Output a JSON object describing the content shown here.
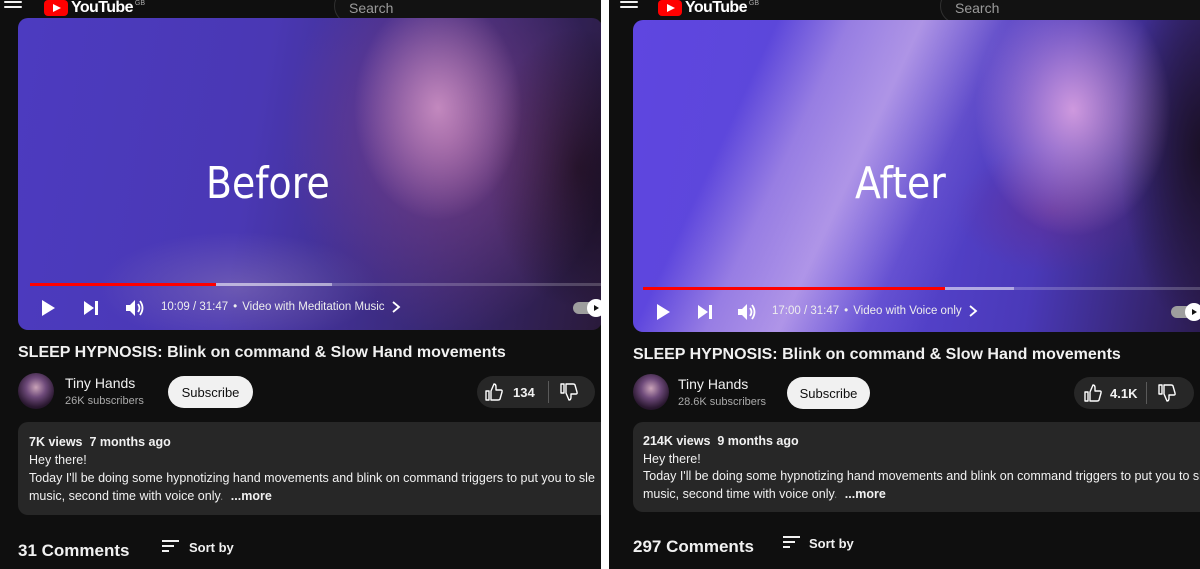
{
  "left": {
    "search_placeholder": "Search",
    "logo_text": "YouTube",
    "logo_sup": "GB",
    "overlay_caption": "Before",
    "time": "10:09 / 31:47",
    "chapter": "Video with Meditation Music",
    "progress_played": 0.32,
    "progress_buffered": 0.52,
    "title": "SLEEP HYPNOSIS: Blink on command & Slow Hand movements",
    "channel": "Tiny Hands",
    "subscribers": "26K subscribers",
    "subscribe_label": "Subscribe",
    "likes": "134",
    "views": "7K views",
    "age": "7 months ago",
    "desc_line1": "Hey there!",
    "desc_line2": "Today I'll be doing some hypnotizing hand movements and blink on command triggers to put you to sle",
    "desc_line3": "music, second time with voice only",
    "desc_fade": ".",
    "more_label": "...more",
    "comments": "31 Comments",
    "sort_by": "Sort by"
  },
  "right": {
    "search_placeholder": "Search",
    "logo_text": "YouTube",
    "logo_sup": "GB",
    "overlay_caption": "After",
    "time": "17:00 / 31:47",
    "chapter": "Video with Voice only",
    "progress_played": 0.53,
    "progress_buffered": 0.65,
    "title": "SLEEP HYPNOSIS: Blink on command & Slow Hand movements",
    "channel": "Tiny Hands",
    "subscribers": "28.6K subscribers",
    "subscribe_label": "Subscribe",
    "likes": "4.1K",
    "views": "214K views",
    "age": "9 months ago",
    "desc_line1": "Hey there!",
    "desc_line2": "Today I'll be doing some hypnotizing hand movements and blink on command triggers to put you to sle",
    "desc_line3": "music, second time with voice only",
    "desc_fade": ".",
    "more_label": "...more",
    "comments": "297 Comments",
    "sort_by": "Sort by"
  },
  "colors": {
    "background": "#0f0f0f",
    "accent": "#ff0000",
    "card": "#272727",
    "video_tint": "#5a3fd0"
  },
  "icons": [
    "menu-icon",
    "youtube-logo-icon",
    "play-icon",
    "next-icon",
    "volume-icon",
    "chevron-right-icon",
    "autoplay-toggle",
    "thumbs-up-icon",
    "thumbs-down-icon",
    "sort-icon"
  ]
}
